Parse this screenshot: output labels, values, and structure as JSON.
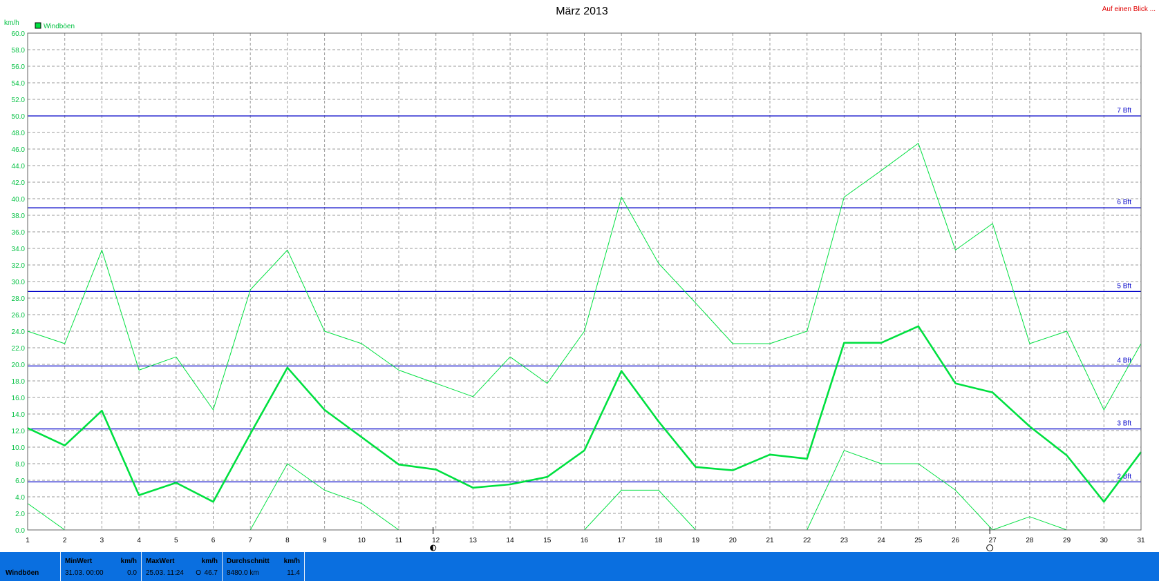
{
  "chart_data": {
    "type": "line",
    "title": "März 2013",
    "ylabel": "km/h",
    "ylim": [
      0,
      60
    ],
    "ytick_step": 2,
    "x": [
      1,
      2,
      3,
      4,
      5,
      6,
      7,
      8,
      9,
      10,
      11,
      12,
      13,
      14,
      15,
      16,
      17,
      18,
      19,
      20,
      21,
      22,
      23,
      24,
      25,
      26,
      27,
      28,
      29,
      30,
      31
    ],
    "xtick_labels": [
      "1",
      "2",
      "3",
      "4",
      "5",
      "6",
      "7",
      "8",
      "9",
      "10",
      "11",
      "12",
      "13",
      "14",
      "15",
      "16",
      "17",
      "18",
      "19",
      "20",
      "21",
      "22",
      "23",
      "24",
      "25",
      "26",
      "27",
      "28",
      "29",
      "30",
      "31"
    ],
    "legend": {
      "label": "Windböen",
      "placement": "top-left",
      "color": "#00e040"
    },
    "series": [
      {
        "name": "Windböen",
        "role": "average",
        "color": "#00e040",
        "values": [
          12.3,
          10.2,
          14.4,
          4.2,
          5.7,
          3.4,
          11.6,
          19.6,
          14.5,
          11.2,
          7.9,
          7.3,
          5.1,
          5.5,
          6.4,
          9.6,
          19.2,
          13.1,
          7.6,
          7.2,
          9.1,
          8.6,
          22.6,
          22.6,
          24.6,
          17.7,
          16.6,
          12.5,
          9.0,
          3.4,
          9.4
        ]
      },
      {
        "role": "max",
        "color": "#00e040",
        "values": [
          24.0,
          22.5,
          33.8,
          19.3,
          20.9,
          14.5,
          29.0,
          33.8,
          24.0,
          22.5,
          19.3,
          17.7,
          16.1,
          20.9,
          17.7,
          24.0,
          40.2,
          32.2,
          27.4,
          22.5,
          22.5,
          24.0,
          40.2,
          43.4,
          46.7,
          33.8,
          37.0,
          22.5,
          24.0,
          14.5,
          22.5
        ]
      },
      {
        "role": "min",
        "color": "#00e040",
        "values": [
          3.2,
          0.0,
          null,
          null,
          null,
          null,
          0.0,
          8.0,
          4.8,
          3.2,
          0.0,
          null,
          null,
          null,
          null,
          0.0,
          4.8,
          4.8,
          0.0,
          null,
          null,
          0.0,
          9.6,
          8.0,
          8.0,
          4.8,
          0.0,
          1.6,
          0.0,
          null,
          null
        ]
      }
    ],
    "bft_lines": [
      {
        "label": "2 Bft",
        "value": 5.8
      },
      {
        "label": "3 Bft",
        "value": 12.2
      },
      {
        "label": "4 Bft",
        "value": 19.8
      },
      {
        "label": "5 Bft",
        "value": 28.8
      },
      {
        "label": "6 Bft",
        "value": 38.9
      },
      {
        "label": "7 Bft",
        "value": 50.0
      }
    ],
    "moon_markers": [
      {
        "day": 12,
        "icon": "half-moon-icon"
      },
      {
        "day": 27,
        "icon": "full-moon-icon"
      }
    ],
    "grid": true
  },
  "header": {
    "link": "Auf einen Blick ..."
  },
  "footer": {
    "series_label": "Windböen",
    "min": {
      "title": "MinWert",
      "unit": "km/h",
      "time": "31.03.  00:00",
      "value": "0.0"
    },
    "max": {
      "title": "MaxWert",
      "unit": "km/h",
      "time": "25.03.  11:24",
      "dir": "O",
      "value": "46.7"
    },
    "avg": {
      "title": "Durchschnitt",
      "unit": "km/h",
      "distance": "8480.0 km",
      "value": "11.4"
    }
  },
  "colors": {
    "series": "#00e040",
    "bft": "#0000c8",
    "footer_bg": "#0a6fe0",
    "link": "#e00000"
  }
}
